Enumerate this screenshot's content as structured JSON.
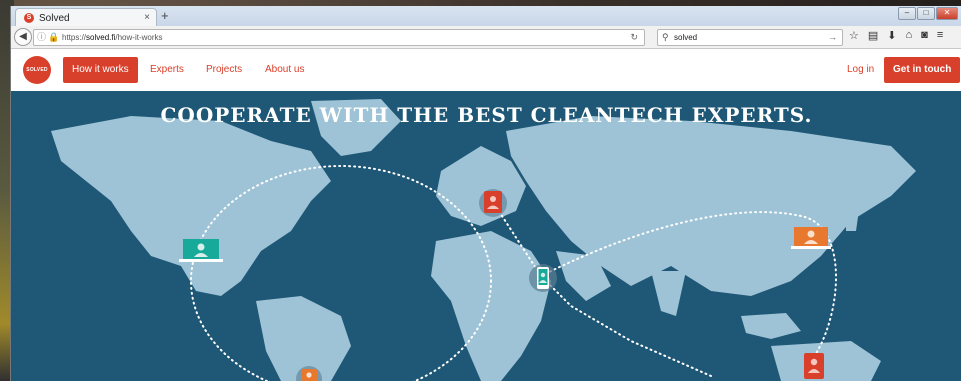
{
  "browser": {
    "tab_title": "Solved",
    "tab_favicon_letter": "S",
    "tab_close": "×",
    "new_tab": "+",
    "url_prefix": "https://",
    "url_domain": "solved.fi",
    "url_path": "/how-it-works",
    "search_value": "solved",
    "icons": [
      "star-icon",
      "bookmarks-icon",
      "download-icon",
      "home-icon",
      "pocket-icon",
      "menu-icon"
    ]
  },
  "site": {
    "logo_text": "SOLVED",
    "nav": {
      "active": "How it works",
      "items": [
        "Experts",
        "Projects",
        "About us"
      ]
    },
    "login": "Log in",
    "cta": "Get in touch",
    "headline": "COOPERATE WITH THE BEST CLEANTECH EXPERTS."
  },
  "colors": {
    "brand": "#d9402b",
    "ocean": "#1f5776",
    "land": "#9ec3d6",
    "teal": "#17a99a",
    "orange": "#e9782f"
  }
}
